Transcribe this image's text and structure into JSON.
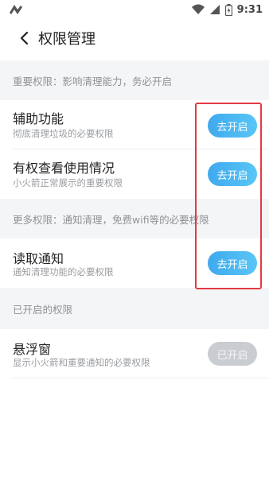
{
  "status_bar": {
    "time": "9:31"
  },
  "header": {
    "title": "权限管理"
  },
  "sections": [
    {
      "header": "重要权限：影响清理能力，务必开启",
      "items": [
        {
          "title": "辅助功能",
          "desc": "彻底清理垃圾的必要权限",
          "button": "去开启"
        },
        {
          "title": "有权查看使用情况",
          "desc": "小火箭正常展示的重要权限",
          "button": "去开启"
        }
      ]
    },
    {
      "header": "更多权限：通知清理，免费wifi等的必要权限",
      "items": [
        {
          "title": "读取通知",
          "desc": "通知清理功能的必要权限",
          "button": "去开启"
        }
      ]
    },
    {
      "header": "已开启的权限",
      "items": [
        {
          "title": "悬浮窗",
          "desc": "显示小火箭和重要通知的必要权限",
          "button": "已开启"
        }
      ]
    }
  ],
  "colors": {
    "accent_gradient_start": "#3fa9ee",
    "accent_gradient_end": "#58c6f6",
    "disabled_button": "#c9ccd1",
    "section_bg": "#f4f5f7",
    "highlight_box": "#e23a44"
  }
}
